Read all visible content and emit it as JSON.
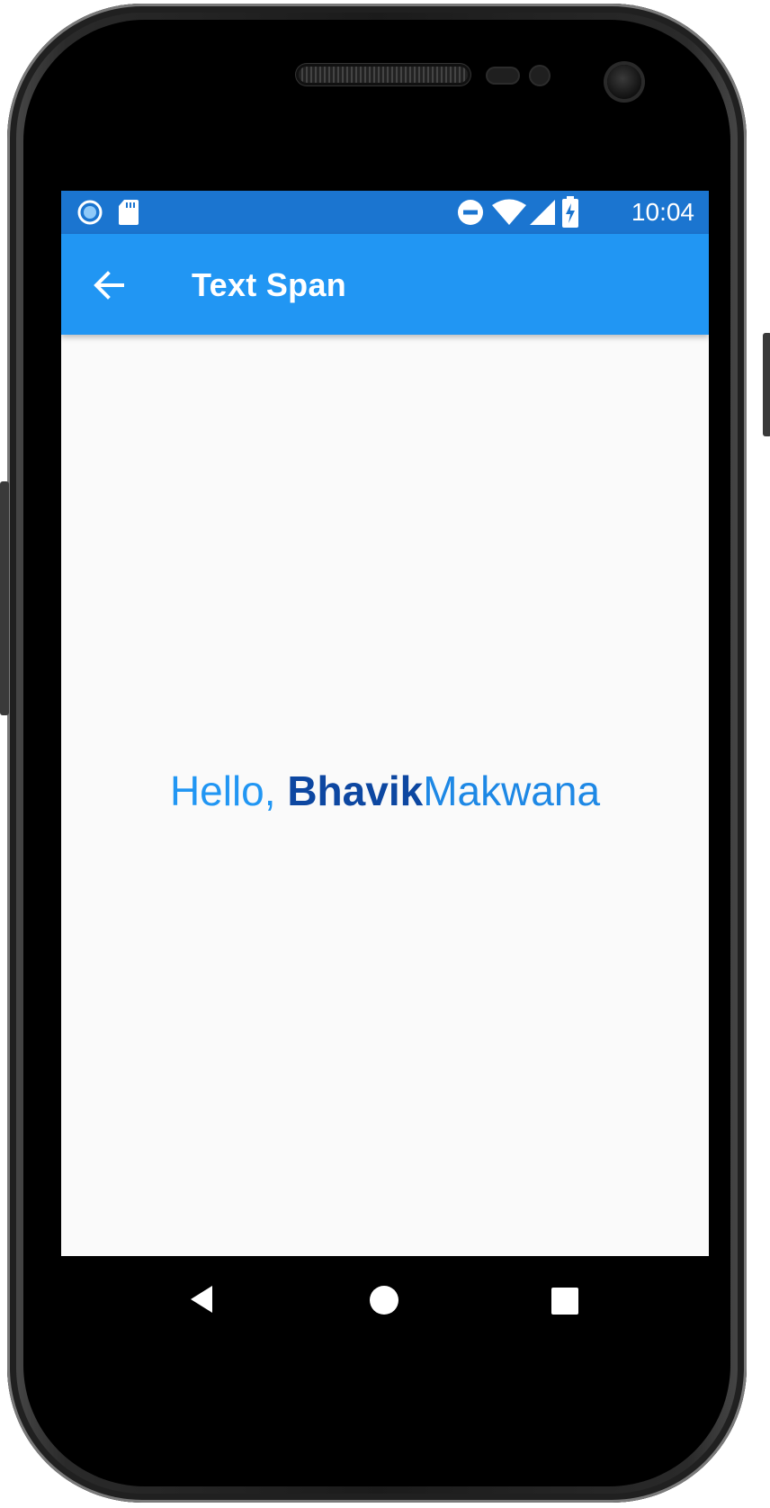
{
  "status_bar": {
    "time": "10:04",
    "left_icons": [
      "circle-notification-icon",
      "sd-card-icon"
    ],
    "right_icons": [
      "do-not-disturb-icon",
      "wifi-icon",
      "signal-icon",
      "battery-charging-icon"
    ]
  },
  "app_bar": {
    "title": "Text Span",
    "back_icon": "arrow-back-icon",
    "color": "#2196f3"
  },
  "content": {
    "span_hello": "Hello, ",
    "span_bhavik": "Bhavik",
    "span_makwana": "Makwana",
    "colors": {
      "hello": "#2196f3",
      "bhavik": "#0d47a1",
      "makwana": "#1e88e5"
    }
  },
  "nav_bar": {
    "buttons": [
      "back-triangle-icon",
      "home-circle-icon",
      "recents-square-icon"
    ]
  }
}
